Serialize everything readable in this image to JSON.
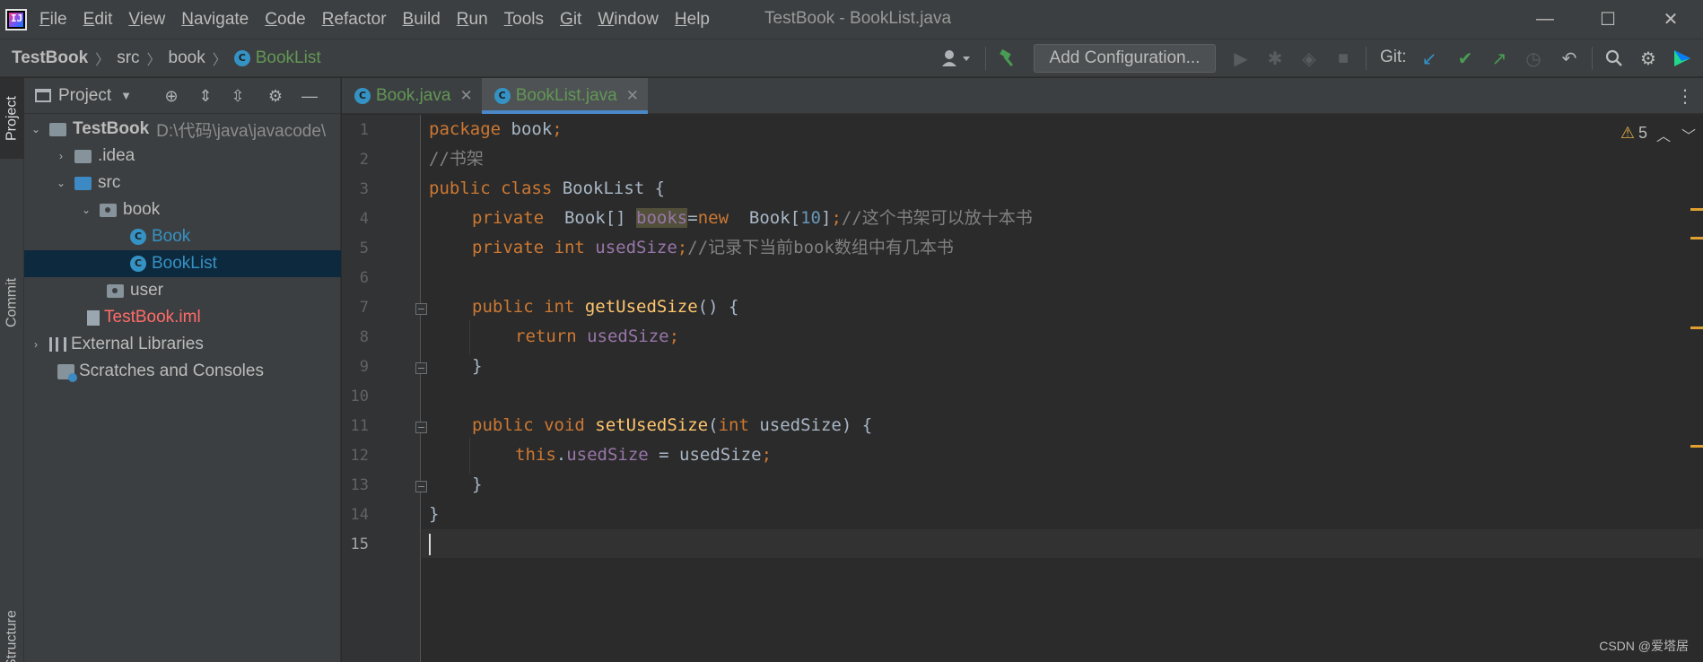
{
  "menubar": {
    "items": [
      {
        "u": "F",
        "rest": "ile"
      },
      {
        "u": "E",
        "rest": "dit"
      },
      {
        "u": "V",
        "rest": "iew"
      },
      {
        "u": "N",
        "rest": "avigate"
      },
      {
        "u": "C",
        "rest": "ode"
      },
      {
        "u": "R",
        "rest": "efactor"
      },
      {
        "u": "B",
        "rest": "uild"
      },
      {
        "u": "R",
        "rest": "un"
      },
      {
        "u": "T",
        "rest": "ools"
      },
      {
        "u": "G",
        "rest": "it"
      },
      {
        "u": "W",
        "rest": "indow"
      },
      {
        "u": "H",
        "rest": "elp"
      }
    ],
    "window_title": "TestBook - BookList.java",
    "minimize": "—",
    "maximize": "☐",
    "close": "✕"
  },
  "toolbar": {
    "breadcrumb": [
      "TestBook",
      "src",
      "book",
      "BookList"
    ],
    "add_configuration": "Add Configuration...",
    "git_label": "Git:"
  },
  "left_strip": {
    "project_tab": "Project",
    "commit_tab": "Commit",
    "structure_tab": "Structure"
  },
  "project_panel": {
    "title": "Project",
    "tree": [
      {
        "label": "TestBook",
        "path": "D:\\代码\\java\\javacode\\"
      },
      {
        "label": ".idea"
      },
      {
        "label": "src"
      },
      {
        "label": "book"
      },
      {
        "label": "Book"
      },
      {
        "label": "BookList"
      },
      {
        "label": "user"
      },
      {
        "label": "TestBook.iml"
      },
      {
        "label": "External Libraries"
      },
      {
        "label": "Scratches and Consoles"
      }
    ]
  },
  "editor": {
    "tabs": [
      {
        "label": "Book.java"
      },
      {
        "label": "BookList.java"
      }
    ],
    "warning_count": "5",
    "line_numbers": [
      "1",
      "2",
      "3",
      "4",
      "5",
      "6",
      "7",
      "8",
      "9",
      "10",
      "11",
      "12",
      "13",
      "14",
      "15"
    ],
    "code": {
      "l1_kw": "package",
      "l1_rest": " book",
      "l1_semi": ";",
      "l2": "//书架",
      "l3_kw": "public class",
      "l3_rest": " BookList {",
      "l4_kw": "private",
      "l4_type": "  Book[] ",
      "l4_field": "books",
      "l4_eq": "=",
      "l4_new": "new",
      "l4_type2": "  Book[",
      "l4_num": "10",
      "l4_close": "]",
      "l4_semi": ";",
      "l4_cmt": "//这个书架可以放十本书",
      "l5_kw": "private int",
      "l5_field": " usedSize",
      "l5_semi": ";",
      "l5_cmt": "//记录下当前book数组中有几本书",
      "l7_kw": "public int",
      "l7_mth": " getUsedSize",
      "l7_rest": "() {",
      "l8_kw": "return",
      "l8_field": " usedSize",
      "l8_semi": ";",
      "l9": "}",
      "l11_kw": "public void",
      "l11_mth": " setUsedSize",
      "l11_p": "(",
      "l11_kw2": "int",
      "l11_rest": " usedSize) {",
      "l12_kw": "this",
      "l12_dot": ".",
      "l12_field": "usedSize",
      "l12_rest": " = usedSize",
      "l12_semi": ";",
      "l13": "}",
      "l14": "}"
    }
  },
  "watermark": "CSDN @爱塔居",
  "colors": {
    "keyword": "#cc7832",
    "field": "#9876aa",
    "method": "#ffc66d",
    "number": "#6897bb",
    "comment": "#808080",
    "java_file": "#3592c4",
    "iml_file": "#ff6b68"
  }
}
